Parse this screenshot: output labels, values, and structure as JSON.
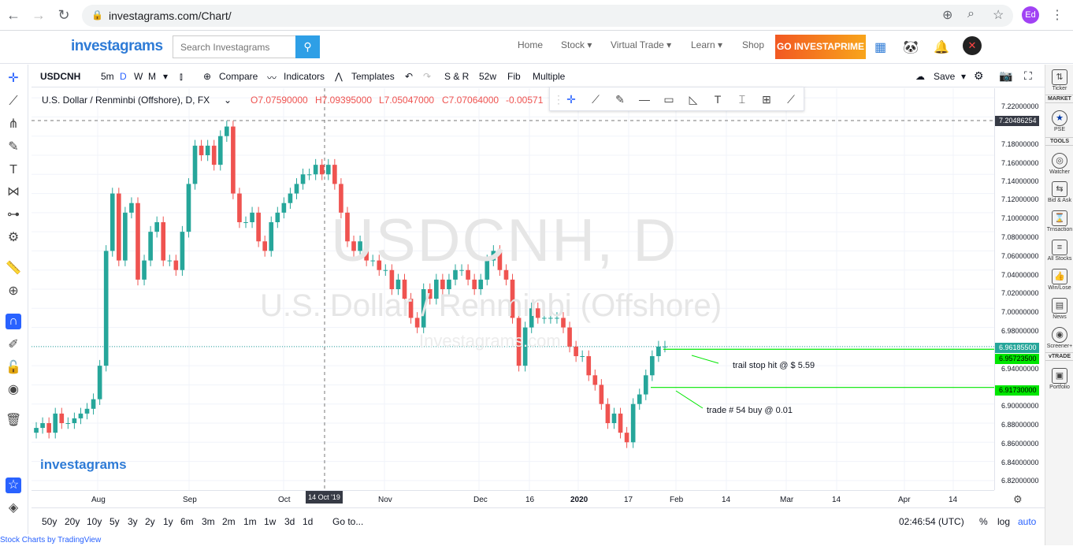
{
  "browser": {
    "url": "investagrams.com/Chart/",
    "avatar_initials": "Ed"
  },
  "site": {
    "logo": "investagrams",
    "search_placeholder": "Search Investagrams",
    "menu": [
      "Home",
      "Stock ▾",
      "Virtual Trade ▾",
      "Learn ▾",
      "Shop"
    ],
    "prime_label": "GO INVESTAPRIME"
  },
  "toolbar": {
    "symbol": "USDCNH",
    "intervals": [
      "5m",
      "D",
      "W",
      "M"
    ],
    "compare": "Compare",
    "indicators": "Indicators",
    "templates": "Templates",
    "sr": "S & R",
    "w52": "52w",
    "fib": "Fib",
    "multiple": "Multiple",
    "save": "Save"
  },
  "legend": {
    "title": "U.S. Dollar / Renminbi (Offshore), D, FX",
    "open": "O7.07590000",
    "high": "H7.09395000",
    "low": "L7.05047000",
    "close": "C7.07064000",
    "change": "-0.00571"
  },
  "watermark": {
    "symbol_line": "USDCNH, D",
    "name_line": "U.S. Dollar / Renminbi (Offshore)",
    "site_line": "Investagrams.com"
  },
  "chart_logo": "investagrams",
  "price_axis": [
    "7.22000000",
    "7.18000000",
    "7.16000000",
    "7.14000000",
    "7.12000000",
    "7.10000000",
    "7.08000000",
    "7.06000000",
    "7.04000000",
    "7.02000000",
    "7.00000000",
    "6.98000000",
    "6.94000000",
    "6.90000000",
    "6.88000000",
    "6.86000000",
    "6.84000000",
    "6.82000000"
  ],
  "price_tags": {
    "crosshair": "7.20486254",
    "last": "6.96185500",
    "trail_stop": "6.95723500",
    "buy": "6.91730000"
  },
  "annotations": {
    "trail": "trail stop hit @ $ 5.59",
    "buy": "trade # 54 buy @ 0.01"
  },
  "time_axis": [
    "Aug",
    "Sep",
    "Oct",
    "Nov",
    "Dec",
    "16",
    "2020",
    "17",
    "Feb",
    "14",
    "Mar",
    "14",
    "Apr",
    "14"
  ],
  "crosshair_date": "14 Oct '19",
  "ranges": [
    "50y",
    "20y",
    "10y",
    "5y",
    "3y",
    "2y",
    "1y",
    "6m",
    "3m",
    "2m",
    "1m",
    "1w",
    "3d",
    "1d"
  ],
  "goto": "Go to...",
  "clock": "02:46:54 (UTC)",
  "scale_opts": [
    "%",
    "log",
    "auto"
  ],
  "footer": "Stock Charts by TradingView",
  "right_panel": {
    "ticker": "Ticker",
    "market": "MARKET",
    "pse": "PSE",
    "tools": "TOOLS",
    "watcher": "Watcher",
    "bidask": "Bid & Ask",
    "transaction": "Trnsaction",
    "allstocks": "All Stocks",
    "winlose": "Win/Lose",
    "news": "News",
    "screener": "Screener+",
    "vtrade": "vTRADE",
    "portfolio": "Portfolio"
  },
  "chart_data": {
    "type": "candlestick",
    "title": "U.S. Dollar / Renminbi (Offshore), D, FX",
    "xlabel": "",
    "ylabel": "",
    "ylim": [
      6.81,
      7.23
    ],
    "series": [
      {
        "name": "USDCNH",
        "values": [
          6.875,
          6.88,
          6.87,
          6.89,
          6.88,
          6.88,
          6.885,
          6.89,
          6.895,
          6.905,
          6.94,
          7.06,
          7.12,
          7.05,
          7.1,
          7.11,
          7.03,
          7.05,
          7.08,
          7.09,
          7.05,
          7.05,
          7.04,
          7.08,
          7.13,
          7.17,
          7.16,
          7.17,
          7.15,
          7.18,
          7.19,
          7.12,
          7.09,
          7.09,
          7.1,
          7.07,
          7.06,
          7.09,
          7.1,
          7.11,
          7.12,
          7.13,
          7.14,
          7.14,
          7.15,
          7.14,
          7.15,
          7.13,
          7.1,
          7.07,
          7.06,
          7.07,
          7.05,
          7.05,
          7.04,
          7.04,
          7.02,
          7.03,
          7.01,
          6.99,
          6.98,
          7.02,
          7.01,
          7.03,
          7.02,
          7.03,
          7.04,
          7.04,
          7.03,
          7.02,
          7.03,
          7.05,
          7.06,
          7.04,
          7.03,
          6.99,
          6.94,
          6.98,
          7.0,
          6.99,
          6.99,
          6.99,
          6.99,
          6.98,
          6.96,
          6.95,
          6.95,
          6.93,
          6.92,
          6.9,
          6.88,
          6.89,
          6.87,
          6.86,
          6.9,
          6.91,
          6.93,
          6.95,
          6.96,
          6.96
        ]
      }
    ]
  }
}
